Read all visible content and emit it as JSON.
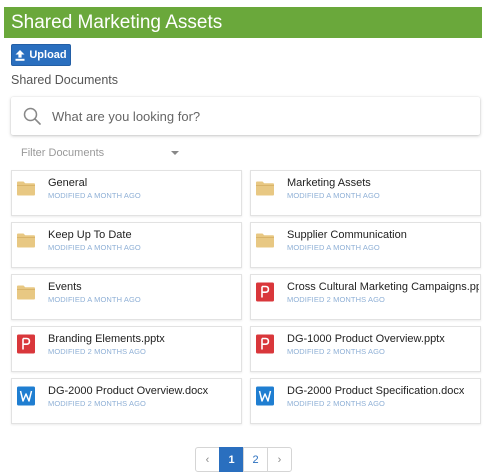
{
  "header": {
    "title": "Shared Marketing Assets"
  },
  "toolbar": {
    "upload_label": "Upload"
  },
  "section": {
    "title": "Shared Documents"
  },
  "search": {
    "placeholder": "What are you looking for?"
  },
  "filter": {
    "label": "Filter Documents"
  },
  "colors": {
    "header_bg": "#6aa83b",
    "accent": "#2a6fbf",
    "folder": "#e8c883",
    "pptx": "#d9373b",
    "docx": "#1f7ed1",
    "modified_text": "#8fb0d6"
  },
  "items": [
    {
      "name": "General",
      "modified": "MODIFIED A MONTH AGO",
      "icon": "folder-icon"
    },
    {
      "name": "Marketing Assets",
      "modified": "MODIFIED A MONTH AGO",
      "icon": "folder-icon"
    },
    {
      "name": "Keep Up To Date",
      "modified": "MODIFIED A MONTH AGO",
      "icon": "folder-icon"
    },
    {
      "name": "Supplier Communication",
      "modified": "MODIFIED A MONTH AGO",
      "icon": "folder-icon"
    },
    {
      "name": "Events",
      "modified": "MODIFIED A MONTH AGO",
      "icon": "folder-icon"
    },
    {
      "name": "Cross Cultural Marketing Campaigns.pptx",
      "modified": "MODIFIED 2 MONTHS AGO",
      "icon": "powerpoint-icon"
    },
    {
      "name": "Branding Elements.pptx",
      "modified": "MODIFIED 2 MONTHS AGO",
      "icon": "powerpoint-icon"
    },
    {
      "name": "DG-1000 Product Overview.pptx",
      "modified": "MODIFIED 2 MONTHS AGO",
      "icon": "powerpoint-icon"
    },
    {
      "name": "DG-2000 Product Overview.docx",
      "modified": "MODIFIED 2 MONTHS AGO",
      "icon": "word-icon"
    },
    {
      "name": "DG-2000 Product Specification.docx",
      "modified": "MODIFIED 2 MONTHS AGO",
      "icon": "word-icon"
    }
  ],
  "pagination": {
    "prev": "‹",
    "pages": [
      "1",
      "2"
    ],
    "current": "1",
    "next": "›"
  }
}
